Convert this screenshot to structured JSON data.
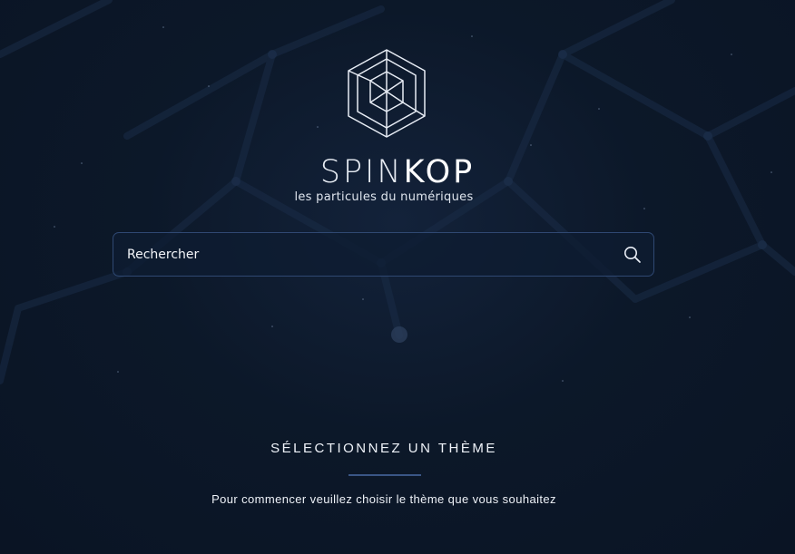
{
  "brand": {
    "name_light": "SPIN",
    "name_bold": "KOP",
    "tagline": "les particules du numériques"
  },
  "search": {
    "placeholder": "Rechercher",
    "icon": "search-icon"
  },
  "theme_section": {
    "title": "SÉLECTIONNEZ UN THÈME",
    "instruction": "Pour commencer veuillez choisir le thème que vous souhaitez"
  },
  "colors": {
    "background": "#0c1829",
    "search_border": "#2f4872",
    "divider": "#3a5686",
    "text": "#eef2f8"
  }
}
